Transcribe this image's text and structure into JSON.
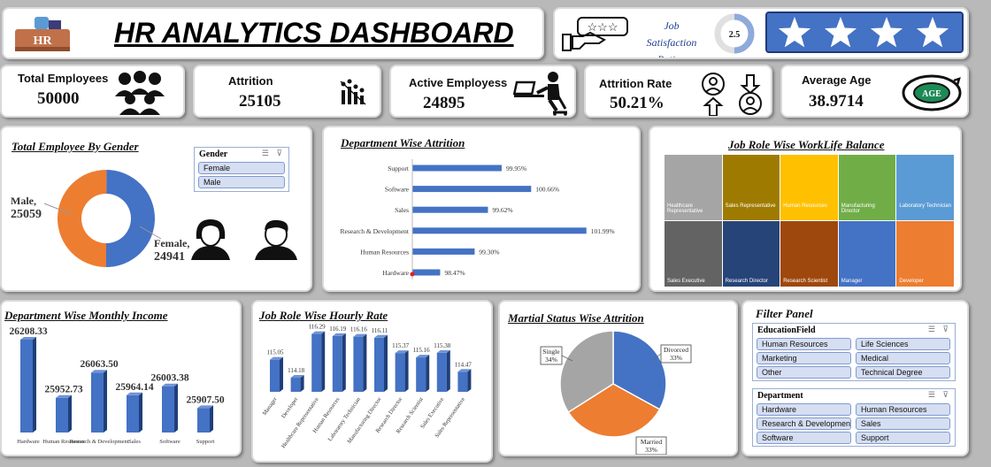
{
  "header": {
    "title": "HR ANALYTICS DASHBOARD",
    "logo_text": "HR"
  },
  "satisfaction": {
    "label_line1": "Job",
    "label_line2": "Satisfaction Rating",
    "rating": "2.5",
    "rating_value": 2.5,
    "rating_max": 5,
    "stars": 4
  },
  "kpis": {
    "total_employees": {
      "label": "Total Employees",
      "value": "50000"
    },
    "attrition": {
      "label": "Attrition",
      "value": "25105"
    },
    "active_employees": {
      "label": "Active Employess",
      "value": "24895"
    },
    "attrition_rate": {
      "label": "Attrition Rate",
      "value": "50.21%"
    },
    "average_age": {
      "label": "Average Age",
      "value": "38.9714",
      "badge": "AGE"
    }
  },
  "gender_panel": {
    "title": "Total Employee By Gender",
    "male_label": "Male,",
    "male_value": "25059",
    "female_label": "Female,",
    "female_value": "24941",
    "slicer": {
      "title": "Gender",
      "items": [
        "Female",
        "Male"
      ]
    }
  },
  "dept_attrition": {
    "title": "Department Wise Attrition"
  },
  "worklife": {
    "title": "Job Role Wise WorkLife Balance"
  },
  "monthly_income": {
    "title": "Department Wise Monthly Income"
  },
  "hourly_rate": {
    "title": "Job Role Wise Hourly Rate"
  },
  "marital": {
    "title": "Martial Status Wise Attrition"
  },
  "filter_panel": {
    "title": "Filter Panel",
    "education": {
      "title": "EducationField",
      "items": [
        "Human Resources",
        "Life Sciences",
        "Marketing",
        "Medical",
        "Other",
        "Technical Degree"
      ]
    },
    "department": {
      "title": "Department",
      "items": [
        "Hardware",
        "Human Resources",
        "Research & Development",
        "Sales",
        "Software",
        "Support"
      ]
    }
  },
  "chart_data": [
    {
      "type": "pie",
      "title": "Total Employee By Gender",
      "categories": [
        "Male",
        "Female"
      ],
      "values": [
        25059,
        24941
      ],
      "colors": [
        "#ed7d31",
        "#4472c4"
      ]
    },
    {
      "type": "bar",
      "orientation": "horizontal",
      "title": "Department Wise Attrition",
      "categories": [
        "Support",
        "Software",
        "Sales",
        "Research & Development",
        "Human Resources",
        "Hardware"
      ],
      "values": [
        99.95,
        100.66,
        99.62,
        101.99,
        99.3,
        98.47
      ],
      "labels": [
        "99.95%",
        "100.66%",
        "99.62%",
        "101.99%",
        "99.30%",
        "98.47%"
      ],
      "xlim": [
        97.8,
        102.4
      ],
      "color": "#4472c4"
    },
    {
      "type": "heatmap",
      "title": "Job Role Wise WorkLife Balance",
      "categories": [
        "Healthcare Representative",
        "Sales Representative",
        "Human Resources",
        "Manufacturing Director",
        "Laboratory Technician",
        "Sales Executive",
        "Research Director",
        "Research Scientist",
        "Manager",
        "Developer"
      ],
      "colors": [
        "#a5a5a5",
        "#9e7b00",
        "#ffc000",
        "#70ad47",
        "#5b9bd5",
        "#636363",
        "#264478",
        "#9e480e",
        "#4472c4",
        "#ed7d31"
      ]
    },
    {
      "type": "bar",
      "title": "Department Wise Monthly Income",
      "categories": [
        "Hardware",
        "Human Resources",
        "Research & Development",
        "Sales",
        "Software",
        "Support"
      ],
      "values": [
        26208.33,
        25952.73,
        26063.5,
        25964.14,
        26003.38,
        25907.5
      ],
      "labels": [
        "26208.33",
        "25952.73",
        "26063.50",
        "25964.14",
        "26003.38",
        "25907.50"
      ],
      "ylim": [
        25800,
        26220
      ],
      "color": "#4472c4"
    },
    {
      "type": "bar",
      "title": "Job Role Wise Hourly Rate",
      "categories": [
        "Manager",
        "Developer",
        "Healthcare Representative",
        "Human Resources",
        "Laboratory Technician",
        "Manufacturing Director",
        "Research Director",
        "Research Scientist",
        "Sales Executive",
        "Sales Representative"
      ],
      "values": [
        115.05,
        114.18,
        116.29,
        116.19,
        116.16,
        116.11,
        115.37,
        115.16,
        115.38,
        114.47
      ],
      "labels": [
        "115.05",
        "114.18",
        "116.29",
        "116.19",
        "116.16",
        "116.11",
        "115.37",
        "115.16",
        "115.38",
        "114.47"
      ],
      "ylim": [
        113.5,
        116.4
      ],
      "color": "#4472c4"
    },
    {
      "type": "pie",
      "title": "Martial Status Wise Attrition",
      "categories": [
        "Divorced",
        "Married",
        "Single"
      ],
      "values": [
        33,
        33,
        34
      ],
      "labels": [
        "33%",
        "33%",
        "34%"
      ],
      "colors": [
        "#4472c4",
        "#ed7d31",
        "#a5a5a5"
      ]
    }
  ]
}
